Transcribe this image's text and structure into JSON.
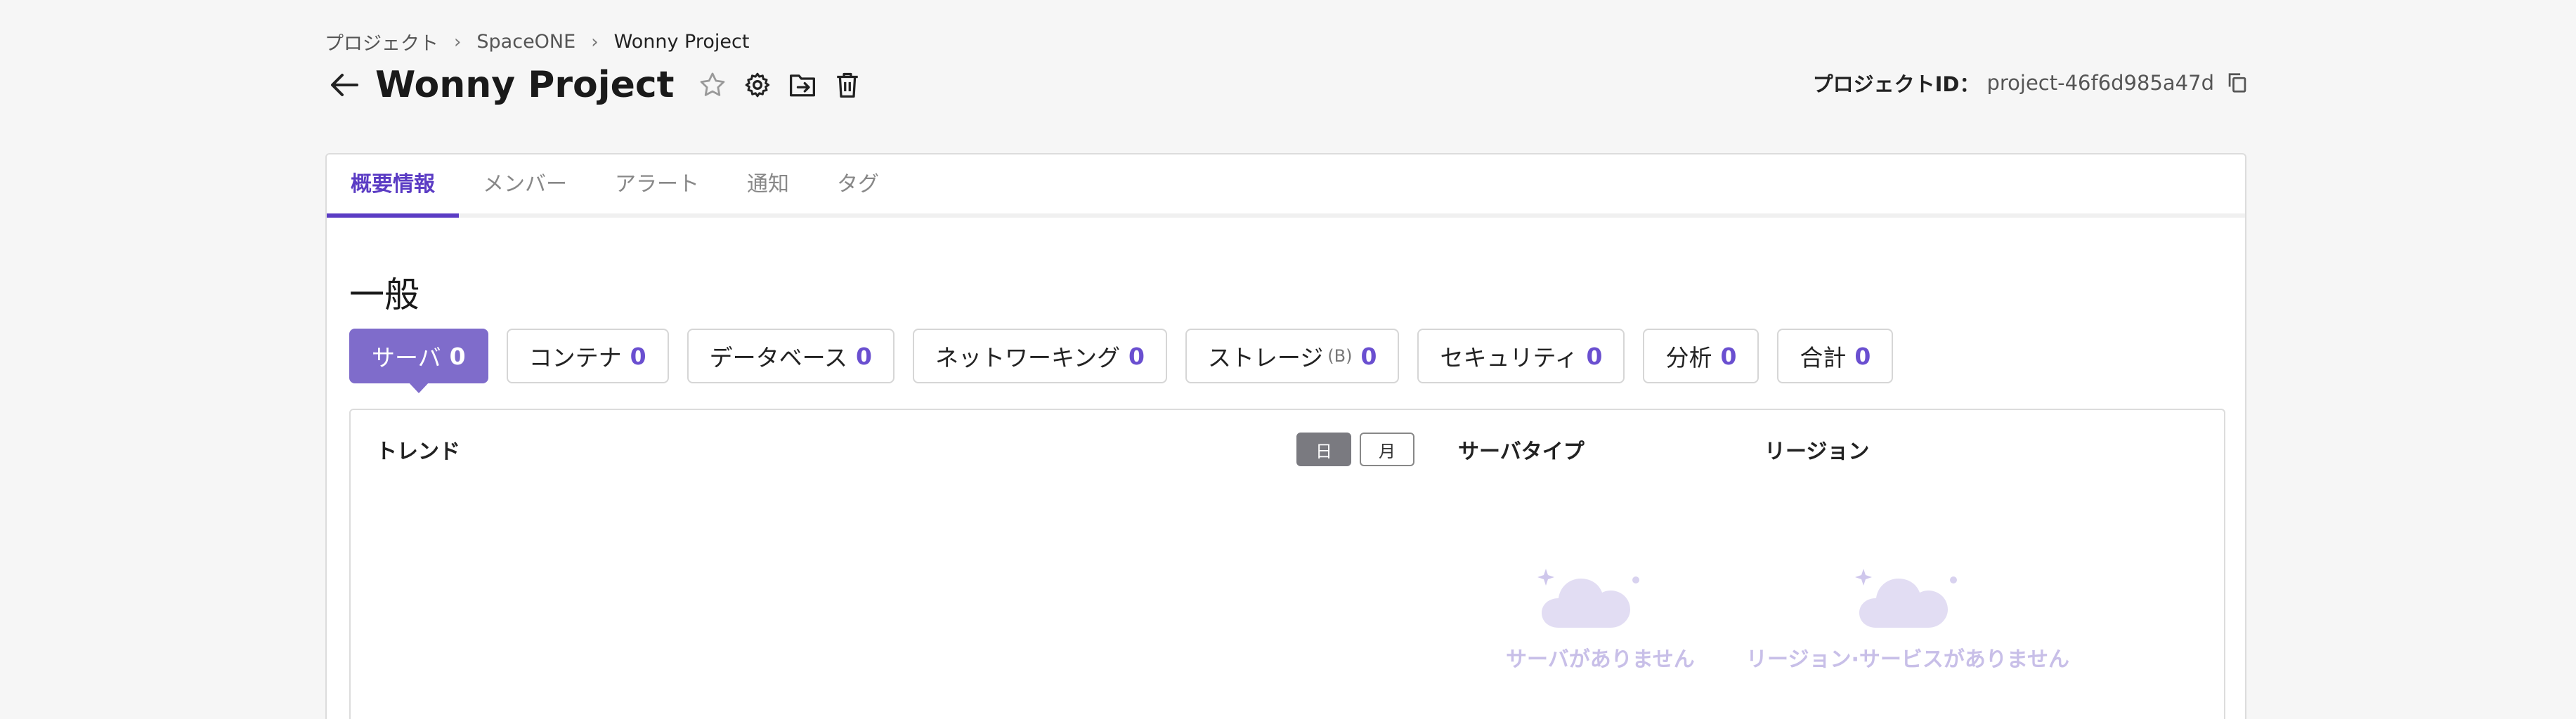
{
  "breadcrumb": {
    "items": [
      "プロジェクト",
      "SpaceONE",
      "Wonny Project"
    ]
  },
  "header": {
    "title": "Wonny Project",
    "project_id_label": "プロジェクトID：",
    "project_id_value": "project-46f6d985a47d"
  },
  "tabs": [
    {
      "label": "概要情報",
      "active": true
    },
    {
      "label": "メンバー"
    },
    {
      "label": "アラート"
    },
    {
      "label": "通知"
    },
    {
      "label": "タグ"
    }
  ],
  "section": {
    "title": "一般"
  },
  "categories": [
    {
      "label": "サーバ",
      "count": "0",
      "active": true
    },
    {
      "label": "コンテナ",
      "count": "0"
    },
    {
      "label": "データベース",
      "count": "0"
    },
    {
      "label": "ネットワーキング",
      "count": "0"
    },
    {
      "label": "ストレージ",
      "suffix": "(B)",
      "count": "0"
    },
    {
      "label": "セキュリティ",
      "count": "0"
    },
    {
      "label": "分析",
      "count": "0"
    },
    {
      "label": "合計",
      "count": "0"
    }
  ],
  "panel": {
    "trend_label": "トレンド",
    "toggle_day": "日",
    "toggle_month": "月",
    "server_type_label": "サーバタイプ",
    "region_label": "リージョン",
    "empty_server": "サーバがありません",
    "empty_region": "リージョン·サービスがありません"
  },
  "colors": {
    "accent": "#5b3cc4",
    "active_chip": "#7f6ccb",
    "empty_text": "#c8bfe8"
  }
}
